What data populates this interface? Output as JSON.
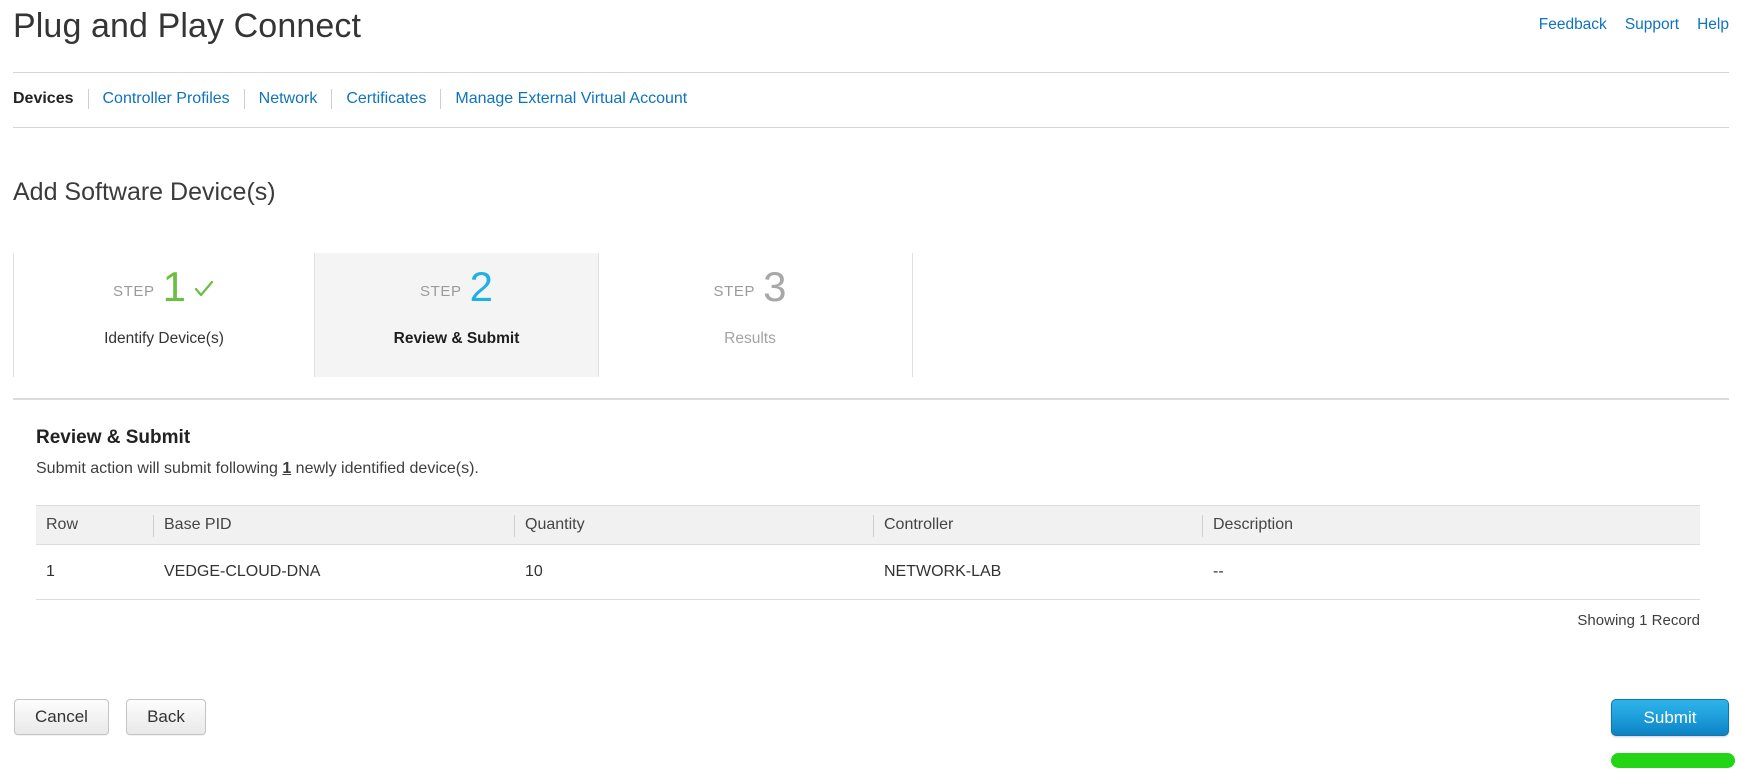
{
  "header": {
    "title": "Plug and Play Connect",
    "links": [
      {
        "label": "Feedback",
        "name": "feedback-link"
      },
      {
        "label": "Support",
        "name": "support-link"
      },
      {
        "label": "Help",
        "name": "help-link"
      }
    ]
  },
  "nav": {
    "tabs": [
      {
        "label": "Devices",
        "active": true
      },
      {
        "label": "Controller Profiles",
        "active": false
      },
      {
        "label": "Network",
        "active": false
      },
      {
        "label": "Certificates",
        "active": false
      },
      {
        "label": "Manage External Virtual Account",
        "active": false
      }
    ]
  },
  "page": {
    "heading": "Add Software Device(s)"
  },
  "steps": {
    "word": "STEP",
    "items": [
      {
        "number": "1",
        "label": "Identify Device(s)",
        "state": "complete"
      },
      {
        "number": "2",
        "label": "Review & Submit",
        "state": "current"
      },
      {
        "number": "3",
        "label": "Results",
        "state": "upcoming"
      }
    ]
  },
  "review": {
    "title": "Review & Submit",
    "subtitle_prefix": "Submit action will submit following ",
    "subtitle_count": "1",
    "subtitle_suffix": " newly identified device(s)."
  },
  "table": {
    "columns": [
      "Row",
      "Base PID",
      "Quantity",
      "Controller",
      "Description"
    ],
    "rows": [
      {
        "row": "1",
        "base_pid": "VEDGE-CLOUD-DNA",
        "quantity": "10",
        "controller": "NETWORK-LAB",
        "description": "--"
      }
    ],
    "footer": "Showing 1 Record"
  },
  "footer": {
    "cancel_label": "Cancel",
    "back_label": "Back",
    "submit_label": "Submit"
  },
  "colors": {
    "link": "#0d74bd",
    "step_complete": "#6cbe45",
    "step_current": "#21b0e5",
    "step_upcoming": "#a8a8a8",
    "submit_button": "#1e9fdc",
    "highlight": "#22d515"
  }
}
